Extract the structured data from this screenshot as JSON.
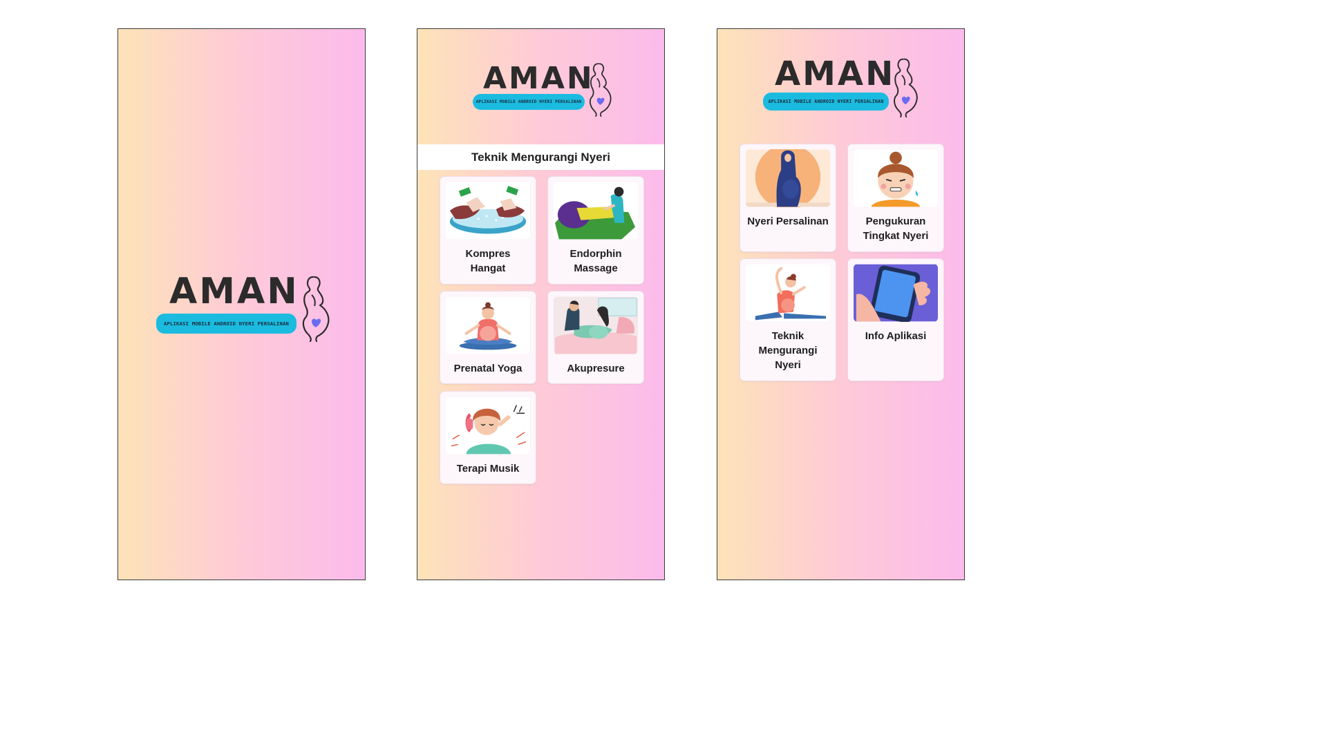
{
  "logo": {
    "title": "AMAN",
    "subtitle": "APLIKASI MOBILE ANDROID NYERI PERSALINAN",
    "pill_color": "#1bbbe0",
    "heart_color": "#6b6bf0"
  },
  "background_gradient": [
    "#fde3b8",
    "#fecad7",
    "#fcbbec"
  ],
  "screen2": {
    "header": "Teknik Mengurangi Nyeri",
    "cards": [
      {
        "label_line1": "Kompres",
        "label_line2": "Hangat",
        "icon": "warm-compress-illustration"
      },
      {
        "label_line1": "Endorphin",
        "label_line2": "Massage",
        "icon": "massage-illustration"
      },
      {
        "label_line1": "Prenatal Yoga",
        "icon": "prenatal-yoga-illustration"
      },
      {
        "label_line1": "Akupresure",
        "icon": "acupressure-illustration"
      },
      {
        "label_line1": "Terapi Musik",
        "icon": "music-therapy-illustration"
      }
    ]
  },
  "screen3": {
    "cards": [
      {
        "label_line1": "Nyeri Persalinan",
        "icon": "pregnant-woman-illustration"
      },
      {
        "label_line1": "Pengukuran",
        "label_line2": "Tingkat Nyeri",
        "icon": "pain-face-illustration"
      },
      {
        "label_line1": "Teknik",
        "label_line2": "Mengurangi",
        "label_line3": "Nyeri",
        "icon": "stretching-illustration"
      },
      {
        "label_line1": "Info Aplikasi",
        "icon": "phone-in-hand-illustration"
      }
    ]
  }
}
